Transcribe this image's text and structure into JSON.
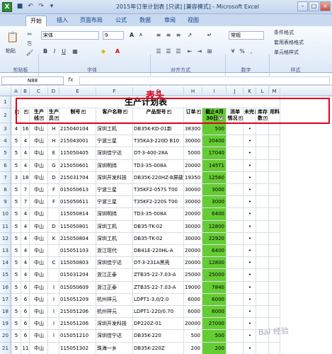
{
  "window": {
    "title": "2015年订单计划表  [只读]  [兼容模式] - Microsoft Excel",
    "app_icon": "X"
  },
  "tabs": [
    "开始",
    "插入",
    "页面布局",
    "公式",
    "数据",
    "审阅",
    "视图"
  ],
  "ribbon": {
    "clipboard": {
      "paste": "粘贴",
      "label": "剪贴板"
    },
    "font": {
      "name": "宋体",
      "size": "9",
      "label": "字体"
    },
    "alignment": {
      "label": "对齐方式"
    },
    "number": {
      "format": "常规",
      "label": "数字"
    },
    "styles": {
      "items": [
        "条件格式",
        "套用表格格式",
        "单元格样式"
      ],
      "label": "样式"
    }
  },
  "formula_bar": {
    "cell": "N88",
    "fx": "fx",
    "value": ""
  },
  "callout": "表头",
  "columns": [
    "A",
    "B",
    "C",
    "D",
    "E",
    "F",
    "G",
    "H",
    "I",
    "J",
    "K",
    "L",
    "M"
  ],
  "title_row": {
    "row": "1",
    "text": "生产计划表"
  },
  "header_row": {
    "row": "2",
    "cells": [
      "",
      "",
      "生产\n线",
      "生产\n员",
      "制号",
      "客户名称",
      "产品型号",
      "订单",
      "截止4月\n30日",
      "消单\n情况",
      "未完",
      "库存\n数",
      "用料"
    ]
  },
  "rows": [
    {
      "n": "3",
      "cells": [
        "4",
        "16",
        "中山",
        "H",
        "215040104",
        "深圳工机",
        "DB35K-KD-01新",
        "38300",
        "500",
        "",
        "•",
        "",
        ""
      ]
    },
    {
      "n": "4",
      "cells": [
        "5",
        "4",
        "中山",
        "H",
        "215043001",
        "宁波三星",
        "T35KA3-220D B10",
        "30000",
        "20400",
        "",
        "•",
        "",
        ""
      ]
    },
    {
      "n": "5",
      "cells": [
        "5",
        "4",
        "中山",
        "E",
        "115050405",
        "深圳佳宁达",
        "DT-3-400-28A",
        "5000",
        "17040",
        "",
        "•",
        "",
        ""
      ]
    },
    {
      "n": "6",
      "cells": [
        "5",
        "4",
        "中山",
        "G",
        "215050601",
        "深圳明纬",
        "TD3-35-008A",
        "20000",
        "145T1",
        "",
        "•",
        "",
        ""
      ]
    },
    {
      "n": "7",
      "cells": [
        "3",
        "18",
        "中山",
        "D",
        "215031704",
        "深圳开发科技",
        "DB35K-220HZ-B屏蔽",
        "19350",
        "12560",
        "",
        "•",
        "",
        ""
      ]
    },
    {
      "n": "8",
      "cells": [
        "5",
        "7",
        "中山",
        "F",
        "015050613",
        "宁波三星",
        "T35KF2-057S T00",
        "30000",
        "3000",
        "",
        "•",
        "",
        ""
      ]
    },
    {
      "n": "9",
      "cells": [
        "5",
        "7",
        "中山",
        "F",
        "015050611",
        "宁波三星",
        "T35KF2-220S T00",
        "30000",
        "3000",
        "",
        "•",
        "",
        ""
      ]
    },
    {
      "n": "10",
      "cells": [
        "5",
        "4",
        "中山",
        "",
        "115050814",
        "深圳明纬",
        "TD3-35-008A",
        "20000",
        "6400",
        "",
        "•",
        "",
        ""
      ]
    },
    {
      "n": "11",
      "cells": [
        "5",
        "4",
        "中山",
        "D",
        "115050801",
        "深圳工机",
        "DB35-TK-02",
        "30000",
        "12800",
        "",
        "•",
        "",
        ""
      ]
    },
    {
      "n": "12",
      "cells": [
        "5",
        "4",
        "中山",
        "K",
        "215050804",
        "深圳工机",
        "DB35-TK-02",
        "30000",
        "22920",
        "",
        "•",
        "",
        ""
      ]
    },
    {
      "n": "13",
      "cells": [
        "5",
        "4",
        "中山",
        "",
        "015051103",
        "浙江现代",
        "DB41E-220HL-A",
        "20000",
        "6400",
        "",
        "•",
        "",
        ""
      ]
    },
    {
      "n": "14",
      "cells": [
        "5",
        "4",
        "中山",
        "C",
        "115050803",
        "深圳佳宁达",
        "DT-3-231A黑壳",
        "20000",
        "12800",
        "",
        "•",
        "",
        ""
      ]
    },
    {
      "n": "15",
      "cells": [
        "5",
        "4",
        "中山",
        "",
        "015031204",
        "浙江正泰",
        "ZTB35-22-7.03-A",
        "25000",
        "25000",
        "",
        "•",
        "",
        ""
      ]
    },
    {
      "n": "16",
      "cells": [
        "5",
        "6",
        "中山",
        "I",
        "015050609",
        "浙江正泰",
        "ZTB35-22-7.03-A",
        "19000",
        "7840",
        "",
        "•",
        "",
        ""
      ]
    },
    {
      "n": "17",
      "cells": [
        "5",
        "6",
        "中山",
        "I",
        "015051209",
        "杭州祥元",
        "LDPT1-3.0/2.0",
        "6000",
        "6000",
        "",
        "•",
        "",
        ""
      ]
    },
    {
      "n": "18",
      "cells": [
        "5",
        "6",
        "中山",
        "I",
        "215051206",
        "杭州祥元",
        "LDPT1-220/0.70",
        "6000",
        "6000",
        "",
        "•",
        "",
        ""
      ]
    },
    {
      "n": "19",
      "cells": [
        "5",
        "6",
        "中山",
        "I",
        "215051206",
        "深圳开发科技",
        "DP220Z-01",
        "20000",
        "27000",
        "",
        "•",
        "",
        ""
      ]
    },
    {
      "n": "20",
      "cells": [
        "5",
        "6",
        "中山",
        "I",
        "015051210",
        "深圳佳宁达",
        "DB35K-220",
        "500",
        "500",
        "",
        "•",
        "",
        ""
      ]
    },
    {
      "n": "21",
      "cells": [
        "5",
        "11",
        "中山",
        "",
        "115051302",
        "珠海一乡",
        "DB35K-220Z",
        "200",
        "200",
        "",
        "•",
        "",
        ""
      ]
    }
  ],
  "watermark": "Bai 经验"
}
